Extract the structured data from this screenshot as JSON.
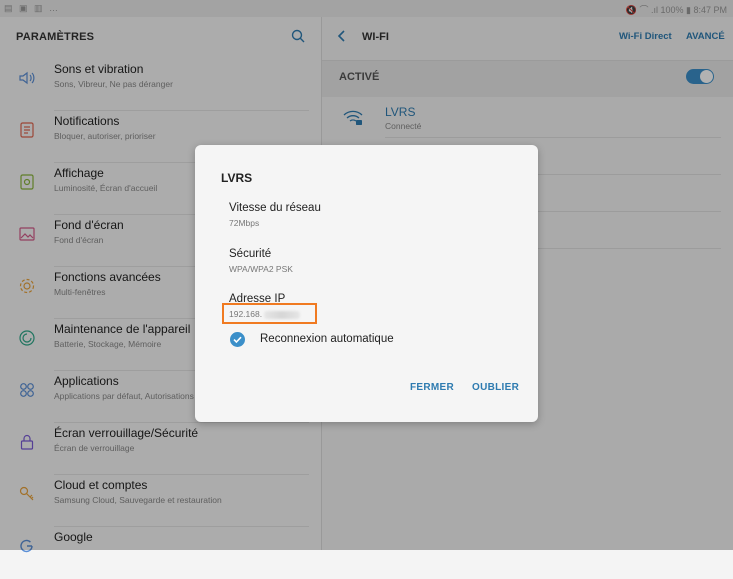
{
  "status_bar": {
    "left_icons": "▤ ▣ ▥ …",
    "right_text": "🔇 ⌒ .ıl 100% ▮ 8:47 PM"
  },
  "settings": {
    "title": "PARAMÈTRES",
    "items": [
      {
        "label": "Sons et vibration",
        "sub": "Sons, Vibreur, Ne pas déranger",
        "icon": "speaker-icon"
      },
      {
        "label": "Notifications",
        "sub": "Bloquer, autoriser, prioriser",
        "icon": "notifications-icon"
      },
      {
        "label": "Affichage",
        "sub": "Luminosité, Écran d'accueil",
        "icon": "display-icon"
      },
      {
        "label": "Fond d'écran",
        "sub": "Fond d'écran",
        "icon": "wallpaper-icon"
      },
      {
        "label": "Fonctions avancées",
        "sub": "Multi-fenêtres",
        "icon": "advanced-features-icon"
      },
      {
        "label": "Maintenance de l'appareil",
        "sub": "Batterie, Stockage, Mémoire",
        "icon": "device-maintenance-icon"
      },
      {
        "label": "Applications",
        "sub": "Applications par défaut, Autorisations",
        "icon": "apps-icon"
      },
      {
        "label": "Écran verrouillage/Sécurité",
        "sub": "Écran de verrouillage",
        "icon": "lock-icon"
      },
      {
        "label": "Cloud et comptes",
        "sub": "Samsung Cloud, Sauvegarde et restauration",
        "icon": "key-icon"
      },
      {
        "label": "Google",
        "sub": "",
        "icon": "google-icon"
      }
    ]
  },
  "wifi": {
    "title": "WI-FI",
    "wifi_direct": "Wi-Fi Direct",
    "advanced": "AVANCÉ",
    "active_label": "ACTIVÉ",
    "toggle_on": true,
    "network": {
      "name": "LVRS",
      "status": "Connecté"
    }
  },
  "dialog": {
    "title": "LVRS",
    "speed_label": "Vitesse du réseau",
    "speed_value": "72Mbps",
    "security_label": "Sécurité",
    "security_value": "WPA/WPA2 PSK",
    "ip_label": "Adresse IP",
    "ip_value": "192.168.",
    "auto_reconnect_label": "Reconnexion automatique",
    "auto_reconnect_checked": true,
    "close_button": "FERMER",
    "forget_button": "OUBLIER"
  },
  "colors": {
    "accent": "#2e7bb0",
    "toggle": "#3b8fc9",
    "highlight": "#f07a21"
  }
}
